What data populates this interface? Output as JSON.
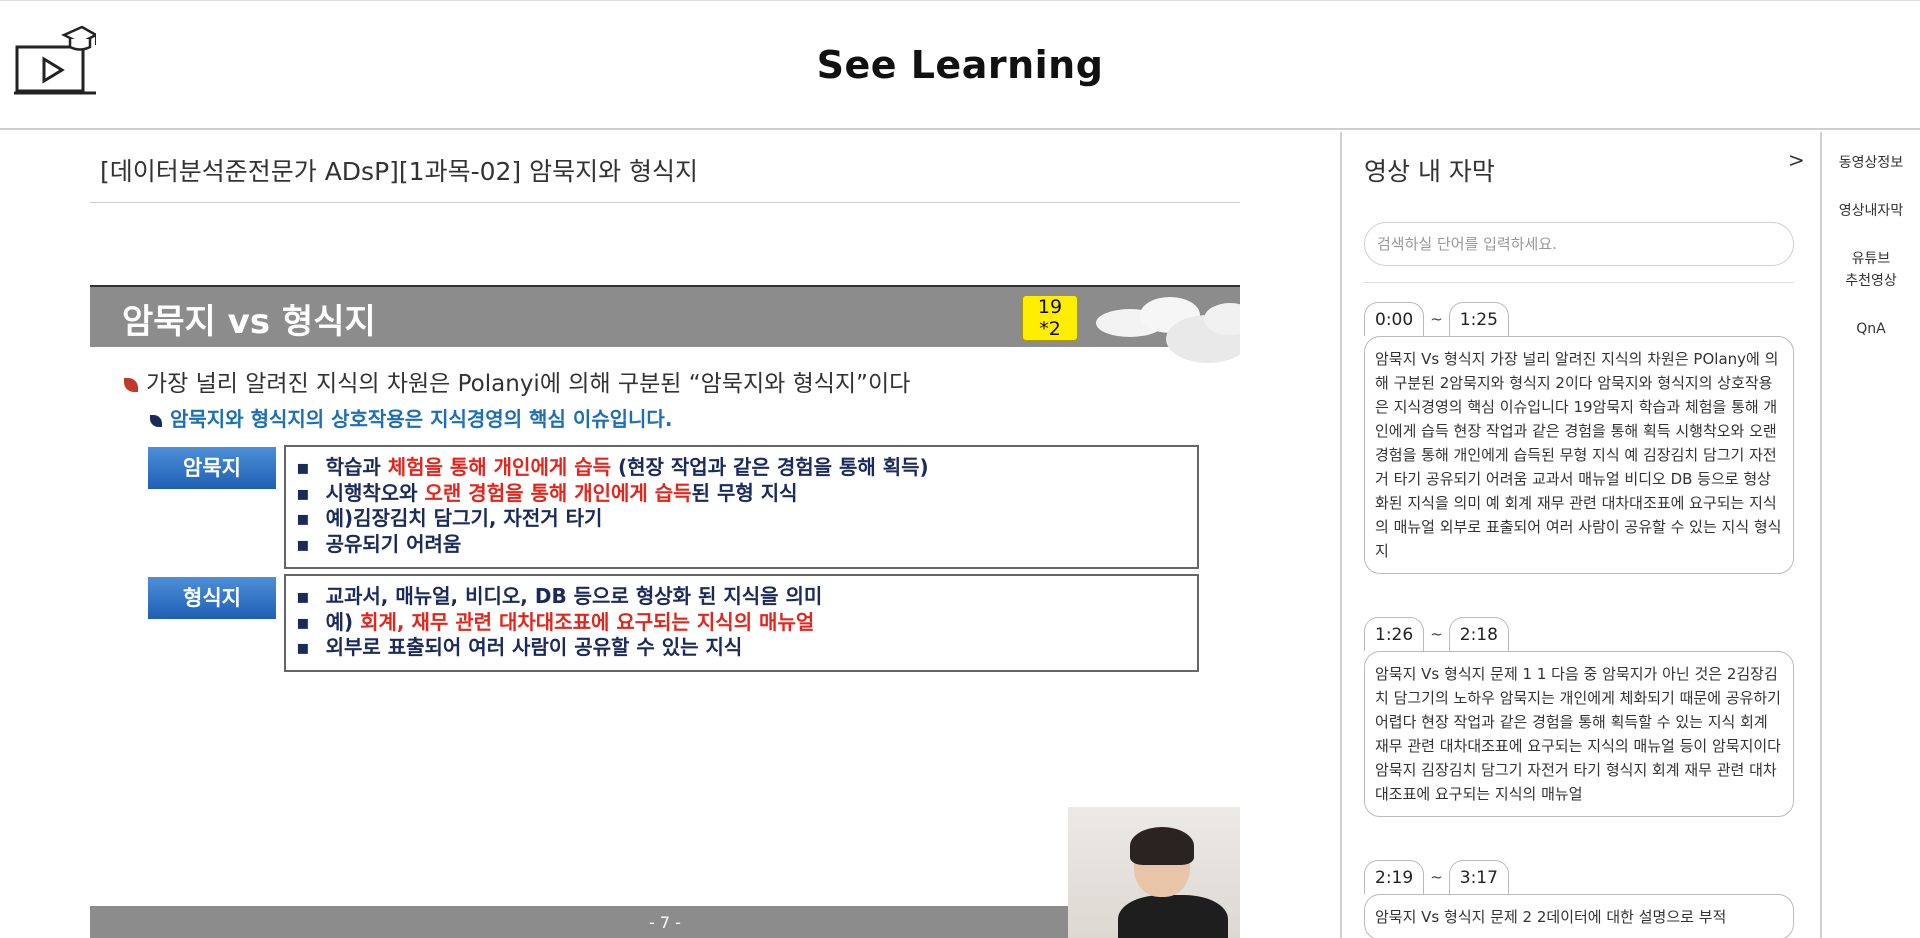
{
  "header": {
    "site_title": "See Learning",
    "logo_icon": "video-course-icon"
  },
  "lecture": {
    "title": "[데이터분석준전문가 ADsP][1과목-02] 암묵지와 형식지"
  },
  "slide": {
    "title": "암묵지 vs 형식지",
    "badge_line1": "19",
    "badge_line2": "*2",
    "bullet_main": "가장 널리 알려진 지식의 차원은 Polanyi에 의해 구분된 “암묵지와 형식지”이다",
    "bullet_sub": "암묵지와 형식지의 상호작용은 지식경영의 핵심 이슈입니다.",
    "tacit_label": "암묵지",
    "tacit": {
      "l1_a": "학습과 ",
      "l1_b": "체험을 통해 개인에게 습득",
      "l1_c": " (현장 작업과 같은 경험을 통해 획득)",
      "l2_a": "시행착오와 ",
      "l2_b": "오랜 경험을 통해 개인에게 습득",
      "l2_c": "된 무형 지식",
      "l3": "예)김장김치 담그기, 자전거 타기",
      "l4": "공유되기 어려움"
    },
    "explicit_label": "형식지",
    "explicit": {
      "l1": "교과서, 매뉴얼, 비디오, DB 등으로 형상화 된 지식을 의미",
      "l2_a": "예) ",
      "l2_b": "회계, 재무 관련 대차대조표에 요구되는 지식의 매뉴얼",
      "l3": "외부로 표출되어 여러 사람이 공유할 수 있는 지식"
    },
    "page_number": "- 7 -"
  },
  "panel": {
    "title": "영상 내 자막",
    "toggle": ">",
    "search_placeholder": "검색하실 단어를 입력하세요.",
    "segments": [
      {
        "start": "0:00",
        "end": "1:25",
        "text": "암묵지 Vs 형식지 가장 널리 알려진 지식의 차원은 POlany에 의해 구분된 2암묵지와 형식지 2이다 암묵지와 형식지의 상호작용은 지식경영의 핵심 이슈입니다 19암묵지 학습과 체험을 통해 개인에게 습득 현장 작업과 같은 경험을 통해 획득 시행착오와 오랜 경험을 통해 개인에게 습득된 무형 지식 예 김장김치 담그기 자전거 타기 공유되기 어려움 교과서 매뉴얼 비디오 DB 등으로 형상화된 지식을 의미 예 회계 재무 관련 대차대조표에 요구되는 지식의 매뉴얼 외부로 표출되어 여러 사람이 공유할 수 있는 지식 형식지"
      },
      {
        "start": "1:26",
        "end": "2:18",
        "text": "암묵지 Vs 형식지 문제 1 1 다음 중 암묵지가 아닌 것은 2김장김치 담그기의 노하우 암묵지는 개인에게 체화되기 때문에 공유하기 어렵다 현장 작업과 같은 경험을 통해 획득할 수 있는 지식 회계 재무 관련 대차대조표에 요구되는 지식의 매뉴얼 등이 암묵지이다 암묵지 김장김치 담그기 자전거 타기 형식지 회계 재무 관련 대차대조표에 요구되는 지식의 매뉴얼"
      },
      {
        "start": "2:19",
        "end": "3:17",
        "text": "암묵지 Vs 형식지 문제 2 2데이터에 대한 설명으로 부적"
      }
    ]
  },
  "rnav": {
    "video_info": "동영상정보",
    "subtitles": "영상내자막",
    "youtube_1": "유튜브",
    "youtube_2": "추천영상",
    "qna": "QnA"
  }
}
